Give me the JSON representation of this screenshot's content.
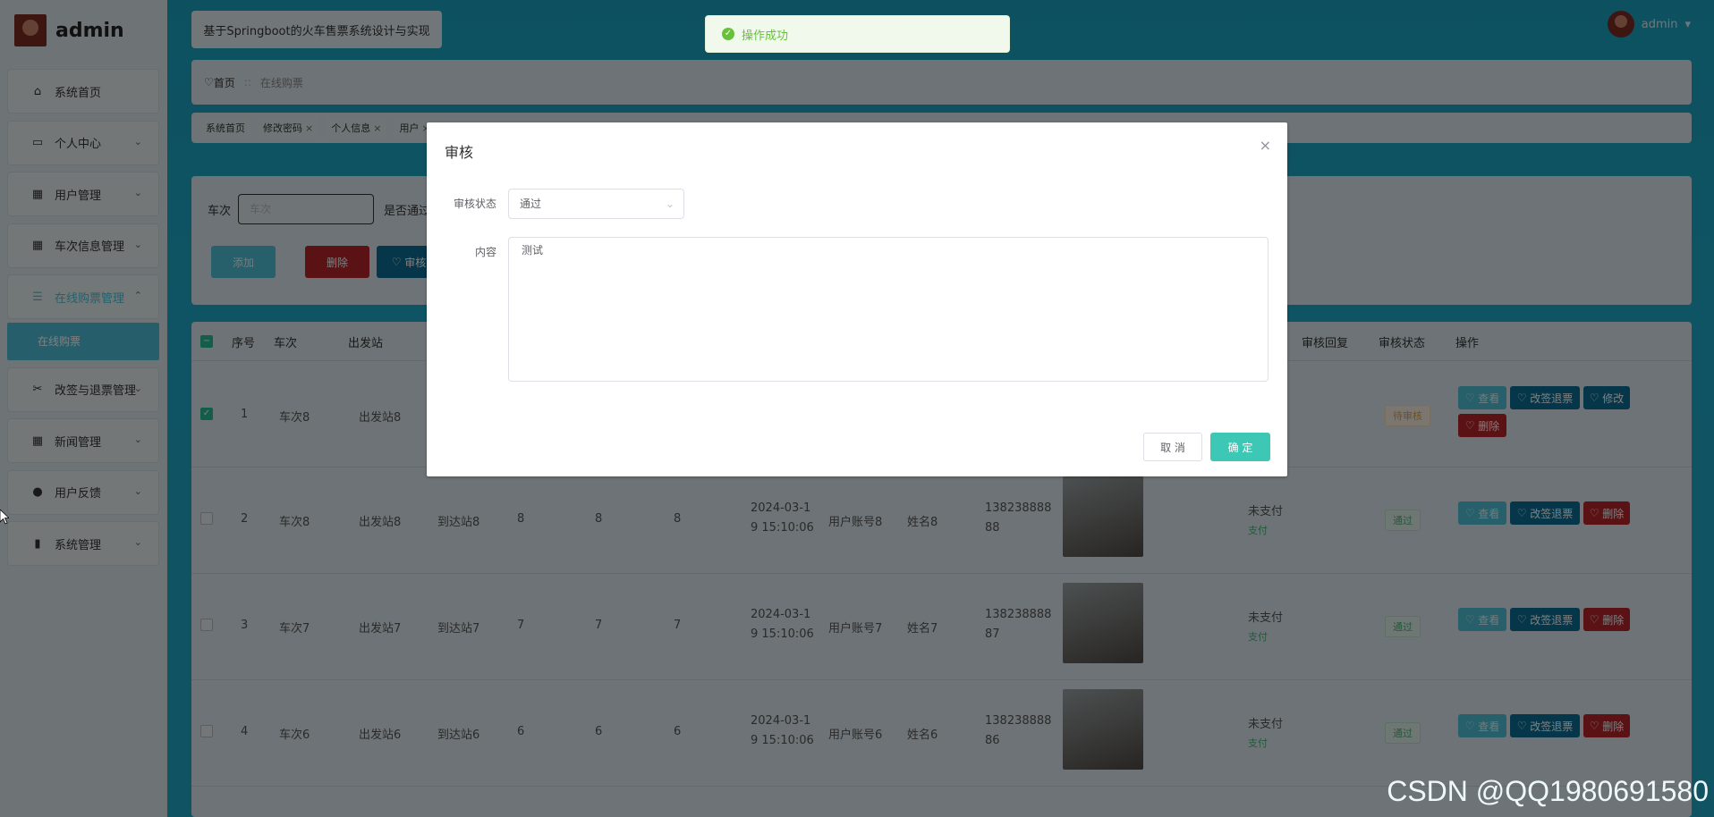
{
  "app": {
    "title": "admin",
    "header_title": "基于Springboot的火车售票系统设计与实现",
    "user": "admin"
  },
  "sidebar": {
    "items": [
      {
        "label": "系统首页"
      },
      {
        "label": "个人中心"
      },
      {
        "label": "用户管理"
      },
      {
        "label": "车次信息管理"
      },
      {
        "label": "在线购票管理"
      },
      {
        "label": "改签与退票管理"
      },
      {
        "label": "新闻管理"
      },
      {
        "label": "用户反馈"
      },
      {
        "label": "系统管理"
      }
    ],
    "sub_item": "在线购票"
  },
  "breadcrumb": {
    "home": "首页",
    "current": "在线购票"
  },
  "tabs": [
    "系统首页",
    "修改密码",
    "个人信息",
    "用户"
  ],
  "search": {
    "label_train": "车次",
    "placeholder": "车次",
    "label_pass": "是否通过"
  },
  "toolbar": {
    "add": "添加",
    "delete": "删除",
    "audit": "审核"
  },
  "table": {
    "headers": [
      "序号",
      "车次",
      "出发站",
      "审核回复",
      "审核状态",
      "操作"
    ],
    "rows": [
      {
        "idx": "1",
        "train": "车次8",
        "from": "出发站8",
        "status": "待审核",
        "actions": [
          "查看",
          "改签退票",
          "修改",
          "删除"
        ]
      },
      {
        "idx": "2",
        "train": "车次8",
        "from": "出发站8",
        "to": "到达站8",
        "a": "8",
        "b": "8",
        "c": "8",
        "time1": "2024-03-1",
        "time2": "9 15:10:06",
        "acct": "用户账号8",
        "name": "姓名8",
        "phone1": "138238888",
        "phone2": "88",
        "pay": "未支付",
        "pay_link": "支付",
        "status": "通过",
        "actions": [
          "查看",
          "改签退票",
          "删除"
        ]
      },
      {
        "idx": "3",
        "train": "车次7",
        "from": "出发站7",
        "to": "到达站7",
        "a": "7",
        "b": "7",
        "c": "7",
        "time1": "2024-03-1",
        "time2": "9 15:10:06",
        "acct": "用户账号7",
        "name": "姓名7",
        "phone1": "138238888",
        "phone2": "87",
        "pay": "未支付",
        "pay_link": "支付",
        "status": "通过",
        "actions": [
          "查看",
          "改签退票",
          "删除"
        ]
      },
      {
        "idx": "4",
        "train": "车次6",
        "from": "出发站6",
        "to": "到达站6",
        "a": "6",
        "b": "6",
        "c": "6",
        "time1": "2024-03-1",
        "time2": "9 15:10:06",
        "acct": "用户账号6",
        "name": "姓名6",
        "phone1": "138238888",
        "phone2": "86",
        "pay": "未支付",
        "pay_link": "支付",
        "status": "通过",
        "actions": [
          "查看",
          "改签退票",
          "删除"
        ]
      }
    ]
  },
  "toast": {
    "text": "操作成功"
  },
  "dialog": {
    "title": "审核",
    "status_label": "审核状态",
    "status_value": "通过",
    "content_label": "内容",
    "content_value": "测试",
    "cancel": "取 消",
    "confirm": "确 定"
  },
  "watermark": "CSDN @QQ1980691580"
}
